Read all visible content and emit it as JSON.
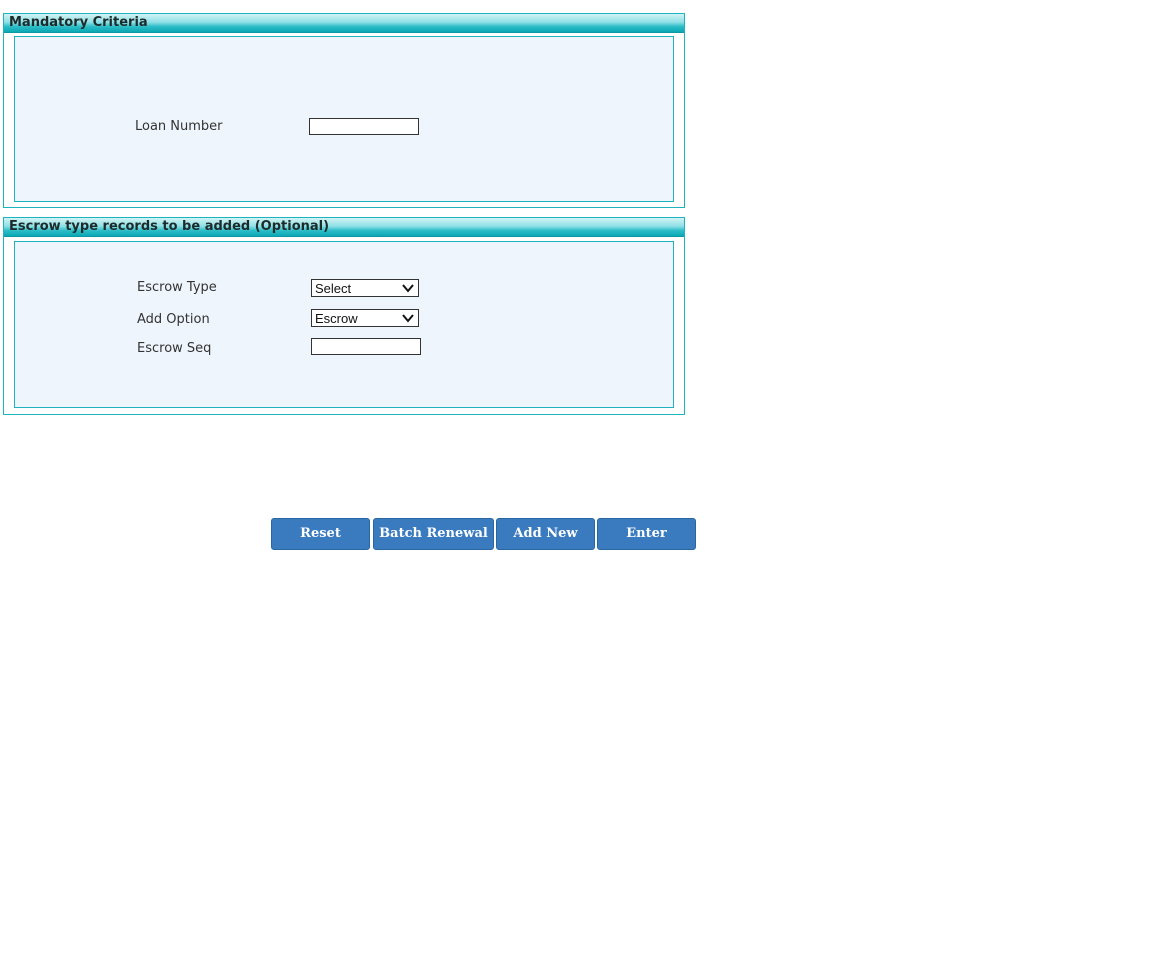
{
  "mandatory_panel": {
    "title": "Mandatory Criteria",
    "loan_number_label": "Loan Number",
    "loan_number_value": ""
  },
  "escrow_panel": {
    "title": "Escrow type records to be added (Optional)",
    "escrow_type_label": "Escrow Type",
    "escrow_type_value": "Select",
    "add_option_label": "Add Option",
    "add_option_value": "Escrow",
    "escrow_seq_label": "Escrow Seq",
    "escrow_seq_value": ""
  },
  "buttons": {
    "reset": "Reset",
    "batch_renewal": "Batch Renewal",
    "add_new": "Add New",
    "enter": "Enter"
  },
  "colors": {
    "panel_border": "#1fb3bf",
    "panel_body_bg": "#eef5fc",
    "button_bg": "#3a7bbf"
  }
}
